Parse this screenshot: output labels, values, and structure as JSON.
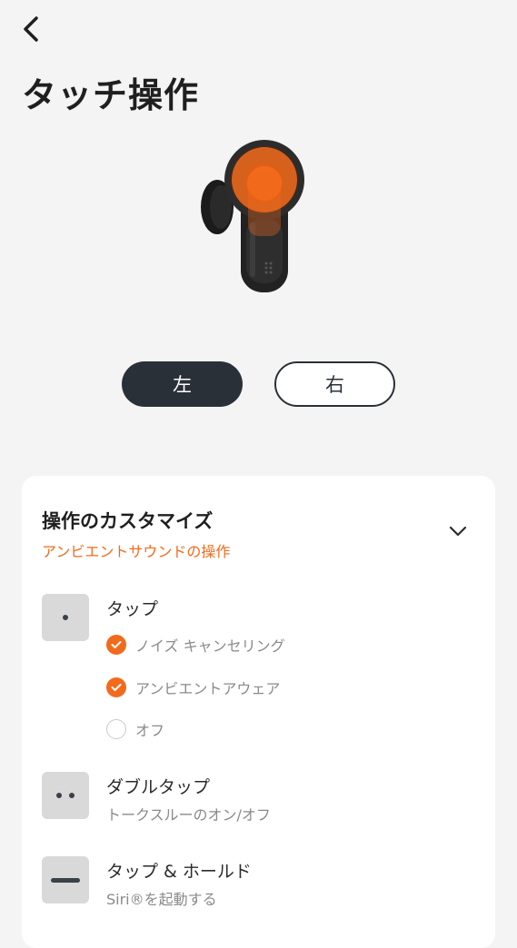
{
  "header": {
    "title": "タッチ操作",
    "back_icon": "chevron-left-icon"
  },
  "product": {
    "image": "earbud-image",
    "accent_color": "#f26b1d"
  },
  "side_toggle": {
    "left": {
      "label": "左",
      "selected": true
    },
    "right": {
      "label": "右",
      "selected": false
    }
  },
  "customize": {
    "title": "操作のカスタマイズ",
    "subtitle": "アンビエントサウンドの操作",
    "expand_icon": "chevron-down-icon",
    "gestures": [
      {
        "icon": "single-tap-icon",
        "title": "タップ",
        "options": [
          {
            "label": "ノイズ キャンセリング",
            "checked": true
          },
          {
            "label": "アンビエントアウェア",
            "checked": true
          },
          {
            "label": "オフ",
            "checked": false
          }
        ]
      },
      {
        "icon": "double-tap-icon",
        "title": "ダブルタップ",
        "description": "トークスルーのオン/オフ"
      },
      {
        "icon": "tap-hold-icon",
        "title": "タップ & ホールド",
        "description": "Siri®を起動する"
      }
    ]
  },
  "colors": {
    "accent": "#f26b1d",
    "dark": "#2a3038",
    "background": "#f4f4f4"
  }
}
